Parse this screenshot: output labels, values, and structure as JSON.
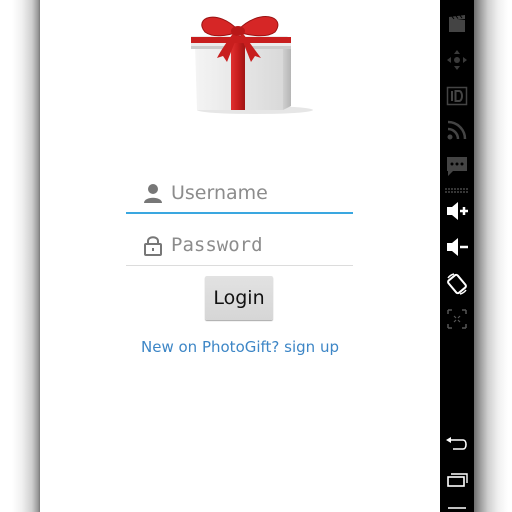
{
  "login_form": {
    "username_placeholder": "Username",
    "password_placeholder": "Password",
    "login_label": "Login",
    "signup_link": "New on PhotoGift? sign up"
  },
  "emulator_toolbar": {
    "icons": [
      "camera-icon",
      "dpad-icon",
      "id-icon",
      "rss-icon",
      "sms-icon",
      "volume-up-icon",
      "volume-down-icon",
      "rotate-icon",
      "crop-icon",
      "back-icon",
      "recents-icon",
      "home-icon"
    ]
  },
  "colors": {
    "accent_underline": "#3aa7e0",
    "link": "#3d86c6",
    "ribbon": "#c81e1e",
    "toolbar_bg": "#000000"
  }
}
